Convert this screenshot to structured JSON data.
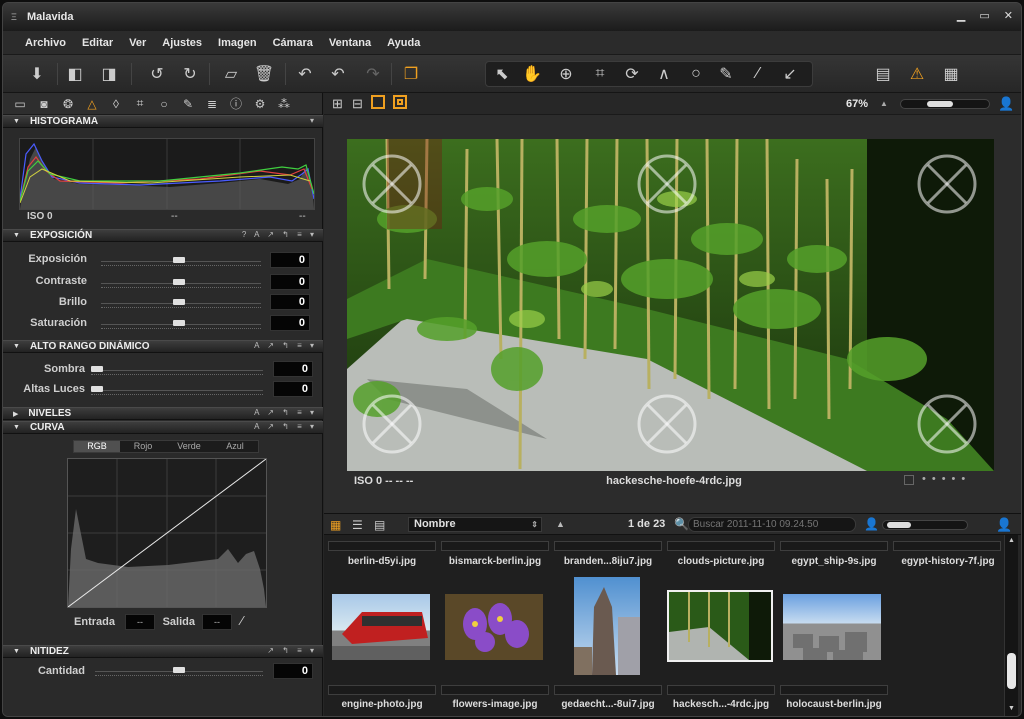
{
  "window": {
    "title": "Malavida"
  },
  "menu": [
    "Archivo",
    "Editar",
    "Ver",
    "Ajustes",
    "Imagen",
    "Cámara",
    "Ventana",
    "Ayuda"
  ],
  "sections": {
    "histograma": "HISTOGRAMA",
    "exposicion": "EXPOSICIÓN",
    "alto_rango": "ALTO RANGO DINÁMICO",
    "niveles": "NIVELES",
    "curva": "CURVA",
    "nitidez": "NITIDEZ"
  },
  "section_icons": {
    "exposicion": "? A ↗ ↰ ≡ ▾",
    "other": "A ↗ ↰ ≡ ▾",
    "short": "↗ ↰ ≡ ▾"
  },
  "histogram": {
    "iso": "ISO 0",
    "mid": "--",
    "right": "--"
  },
  "exposure": [
    {
      "label": "Exposición",
      "value": "0"
    },
    {
      "label": "Contraste",
      "value": "0"
    },
    {
      "label": "Brillo",
      "value": "0"
    },
    {
      "label": "Saturación",
      "value": "0"
    }
  ],
  "hdr": [
    {
      "label": "Sombra",
      "value": "0"
    },
    {
      "label": "Altas Luces",
      "value": "0"
    }
  ],
  "curve": {
    "tabs": [
      "RGB",
      "Rojo",
      "Verde",
      "Azul"
    ],
    "entrada_label": "Entrada",
    "salida_label": "Salida",
    "entrada_value": "--",
    "salida_value": "--"
  },
  "sharpness": {
    "label": "Cantidad",
    "value": "0"
  },
  "viewer": {
    "zoom": "67%",
    "iso_info": "ISO 0 -- -- --",
    "filename": "hackesche-hoefe-4rdc.jpg"
  },
  "browser": {
    "sort": "Nombre",
    "count": "1 de 23",
    "search_placeholder": "Buscar 2011-11-10 09.24.50",
    "top_names": [
      "berlin-d5yi.jpg",
      "bismarck-berlin.jpg",
      "branden...8iju7.jpg",
      "clouds-picture.jpg",
      "egypt_ship-9s.jpg",
      "egypt-history-7f.jpg"
    ],
    "bottom_names": [
      "engine-photo.jpg",
      "flowers-image.jpg",
      "gedaecht...-8ui7.jpg",
      "hackesch...-4rdc.jpg",
      "holocaust-berlin.jpg"
    ]
  },
  "colors": {
    "accent": "#f0a020",
    "warning": "#f08a00"
  }
}
